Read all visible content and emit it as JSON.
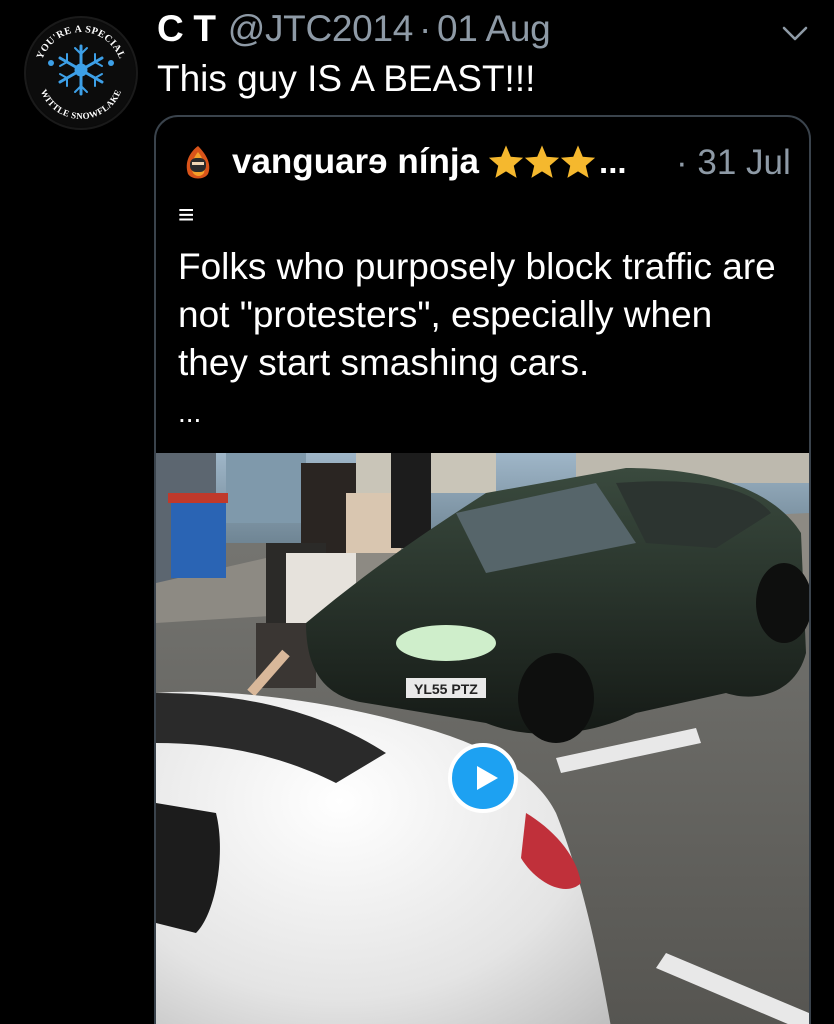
{
  "tweet": {
    "display_name": "C T",
    "handle": "@JTC2014",
    "separator": "·",
    "date": "01 Aug",
    "text": "This guy IS A BEAST!!!",
    "avatar": {
      "icon": "snowflake-badge-icon",
      "top_text": "YOU'RE A SPECIAL",
      "bottom_text": "WITTLE SNOWFLAKE"
    }
  },
  "quote": {
    "display_name": "vanguarɘ nínja",
    "name_suffix": "...",
    "star_count": 3,
    "separator": "·",
    "date": "31 Jul",
    "menu_glyph": "≡",
    "body_lines": [
      "Folks who purposely block traffic are",
      "not \"protesters\", especially when",
      "they start smashing cars."
    ],
    "more": "...",
    "video": {
      "play_icon": "play-icon",
      "plate_text": "YL55 PTZ"
    }
  },
  "colors": {
    "background": "#000000",
    "secondary_text": "#8e9aa6",
    "card_border": "#3a434c",
    "accent": "#1da1f2",
    "star": "#f5b82e"
  }
}
